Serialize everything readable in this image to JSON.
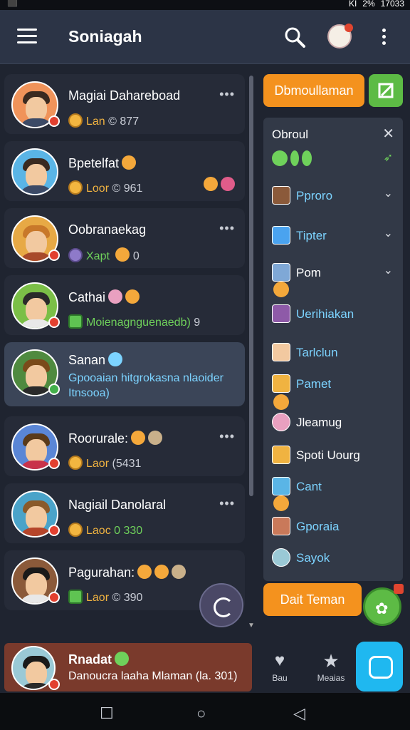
{
  "status": {
    "time": "17033",
    "battery": "2%",
    "left": "⬛",
    "signal": "KI"
  },
  "header": {
    "title": "Soniagah"
  },
  "chats": [
    {
      "name": "Magiai Dahareboad",
      "sub_label": "Lan",
      "sub_num": "© 877",
      "more": "•••",
      "badge": "red",
      "avatar_bg": "#f0935a"
    },
    {
      "name": "Bpetelfat",
      "sub_label": "Loor",
      "sub_num": "© 961",
      "more": "",
      "badge": "none",
      "avatar_bg": "#5ab5e6"
    },
    {
      "name": "Oobranaekag",
      "sub_label": "Xapt",
      "sub_num": "0",
      "more": "•••",
      "badge": "red",
      "avatar_bg": "#e7a945"
    },
    {
      "name": "Cathai",
      "sub_label": "Moienagnguenaedb)",
      "sub_num": "9",
      "more": "",
      "badge": "red",
      "avatar_bg": "#7bbf47"
    },
    {
      "name": "Sanan",
      "preview": "Gpooaian hitgrokasna nlaoider Itnsooa)",
      "badge": "green",
      "avatar_bg": "#4f8a3f"
    },
    {
      "name": "Roorurale:",
      "sub_label": "Laor",
      "sub_num": "(5431",
      "more": "•••",
      "badge": "red",
      "avatar_bg": "#5a86d6"
    },
    {
      "name": "Nagiail Danolaral",
      "sub_label": "Laoc",
      "sub_num": "0 330",
      "more": "•••",
      "badge": "red",
      "avatar_bg": "#4aa3c9"
    },
    {
      "name": "Pagurahan:",
      "sub_label": "Laor",
      "sub_num": "© 390",
      "more": "",
      "badge": "red",
      "avatar_bg": "#8b5a3a"
    }
  ],
  "right": {
    "top_button": "Dbmoullaman",
    "panel_title": "Obroul",
    "items": [
      {
        "label": "Pproro",
        "chev": "⌄"
      },
      {
        "label": "Tipter",
        "chev": "⌄"
      },
      {
        "label": "Pom",
        "chev": "⌄"
      },
      {
        "label": "Uerihiakan",
        "chev": ""
      },
      {
        "label": "Tarlclun",
        "chev": ""
      },
      {
        "label": "Pamet",
        "chev": ""
      },
      {
        "label": "Jleamug",
        "chev": ""
      },
      {
        "label": "Spoti Uourg",
        "chev": ""
      },
      {
        "label": "Cant",
        "chev": ""
      },
      {
        "label": "Gporaia",
        "chev": ""
      },
      {
        "label": "Sayok",
        "chev": ""
      }
    ],
    "add_button": "Dait Teman"
  },
  "bottom_chat": {
    "name": "Rnadat",
    "preview": "Danoucra laaha Mlaman (la. 301)"
  },
  "tabs": {
    "heart": "Bau",
    "star": "Meaias"
  },
  "nav": {
    "square": "☐",
    "circle": "○",
    "back": "◁"
  }
}
